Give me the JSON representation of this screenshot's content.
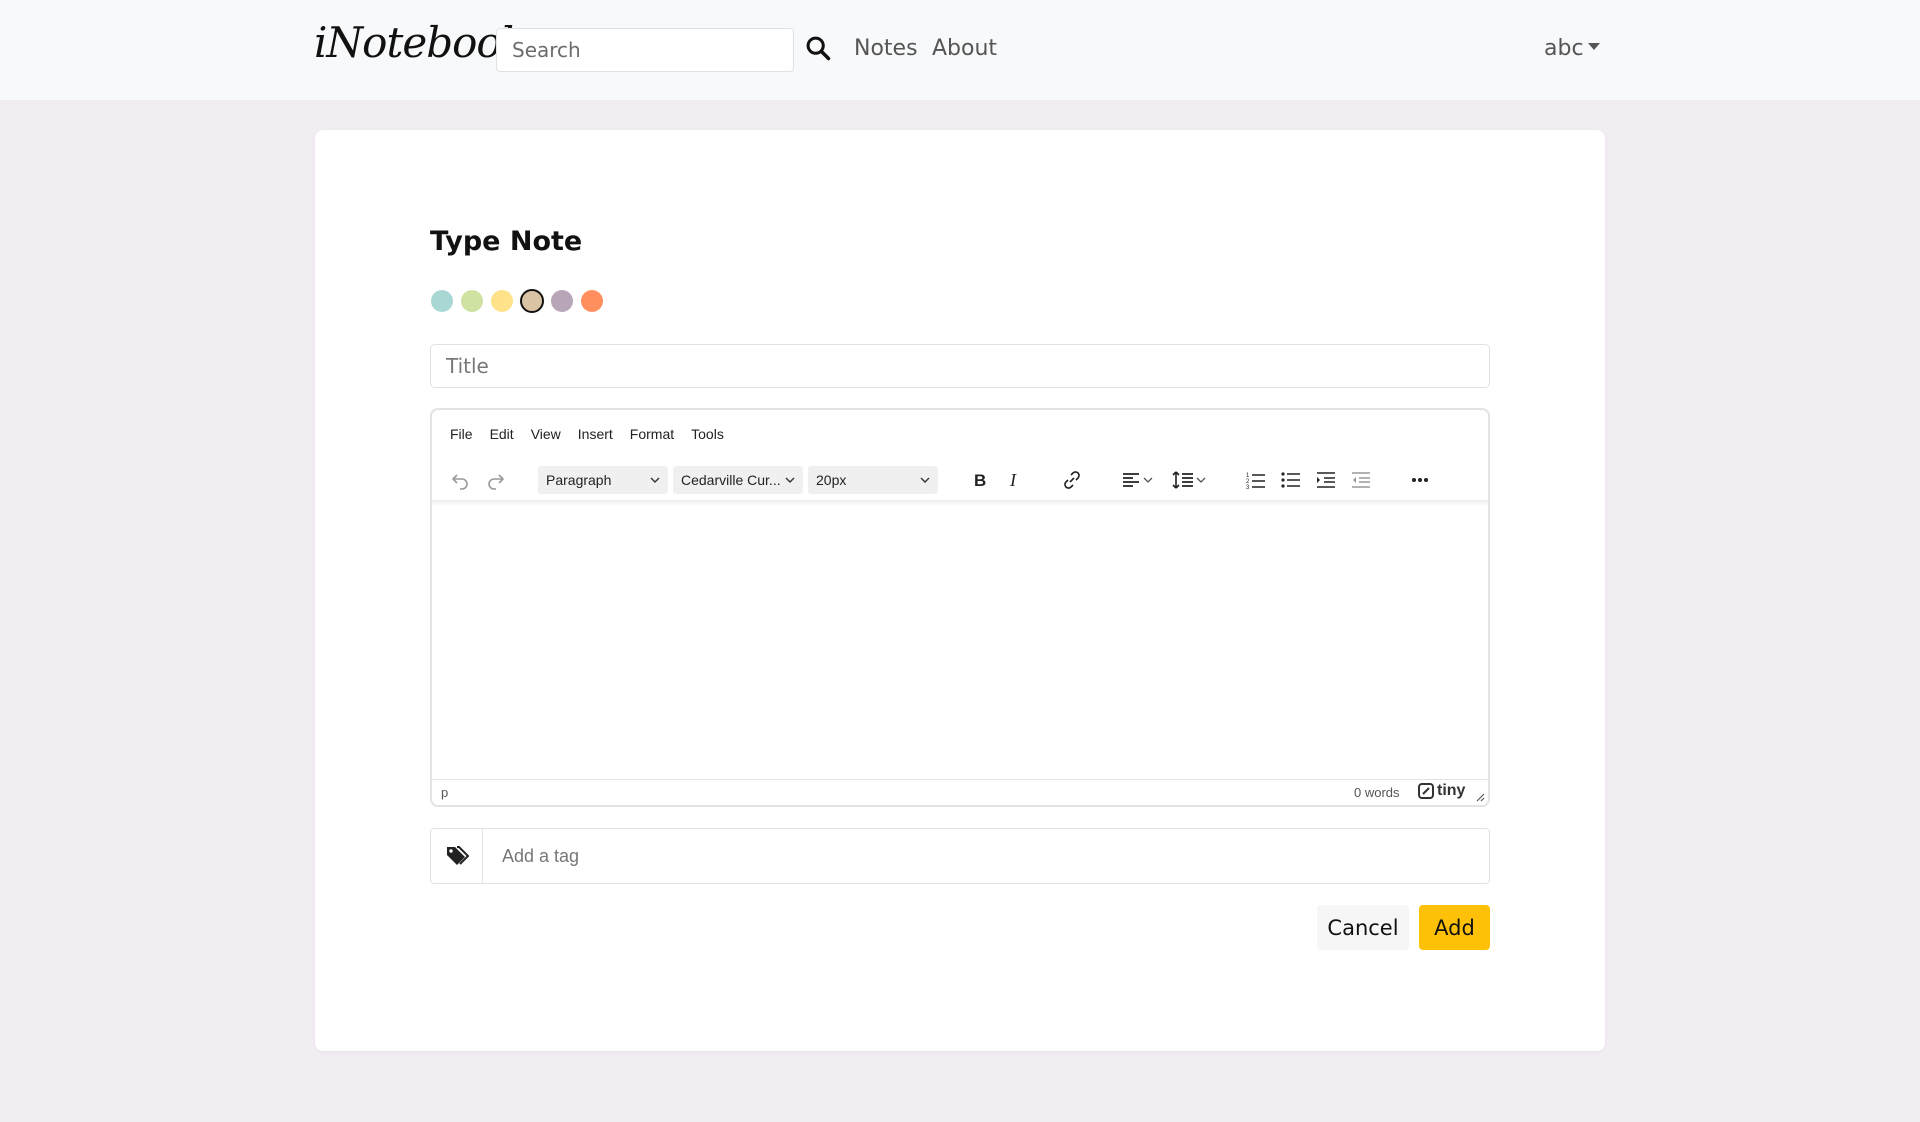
{
  "navbar": {
    "brand": "iNotebook",
    "search_placeholder": "Search",
    "links": [
      "Notes",
      "About"
    ],
    "user": "abc"
  },
  "form": {
    "title": "Type Note",
    "colors": [
      "#a9d8d4",
      "#cfe2a2",
      "#ffe28a",
      "#d9c3a4",
      "#b8a6b8",
      "#ff8f5c"
    ],
    "selected_color_index": 3,
    "title_placeholder": "Title",
    "tag_placeholder": "Add a tag",
    "cancel_label": "Cancel",
    "add_label": "Add"
  },
  "editor": {
    "menu": [
      "File",
      "Edit",
      "View",
      "Insert",
      "Format",
      "Tools"
    ],
    "block_format": "Paragraph",
    "font_family": "Cedarville Cur...",
    "font_size": "20px",
    "status_path": "p",
    "word_count": "0 words",
    "brand": "tiny"
  },
  "colors": {
    "accent": "#ffc107",
    "navbar_bg": "#f8f9fa",
    "page_bg": "#f1edf2"
  }
}
